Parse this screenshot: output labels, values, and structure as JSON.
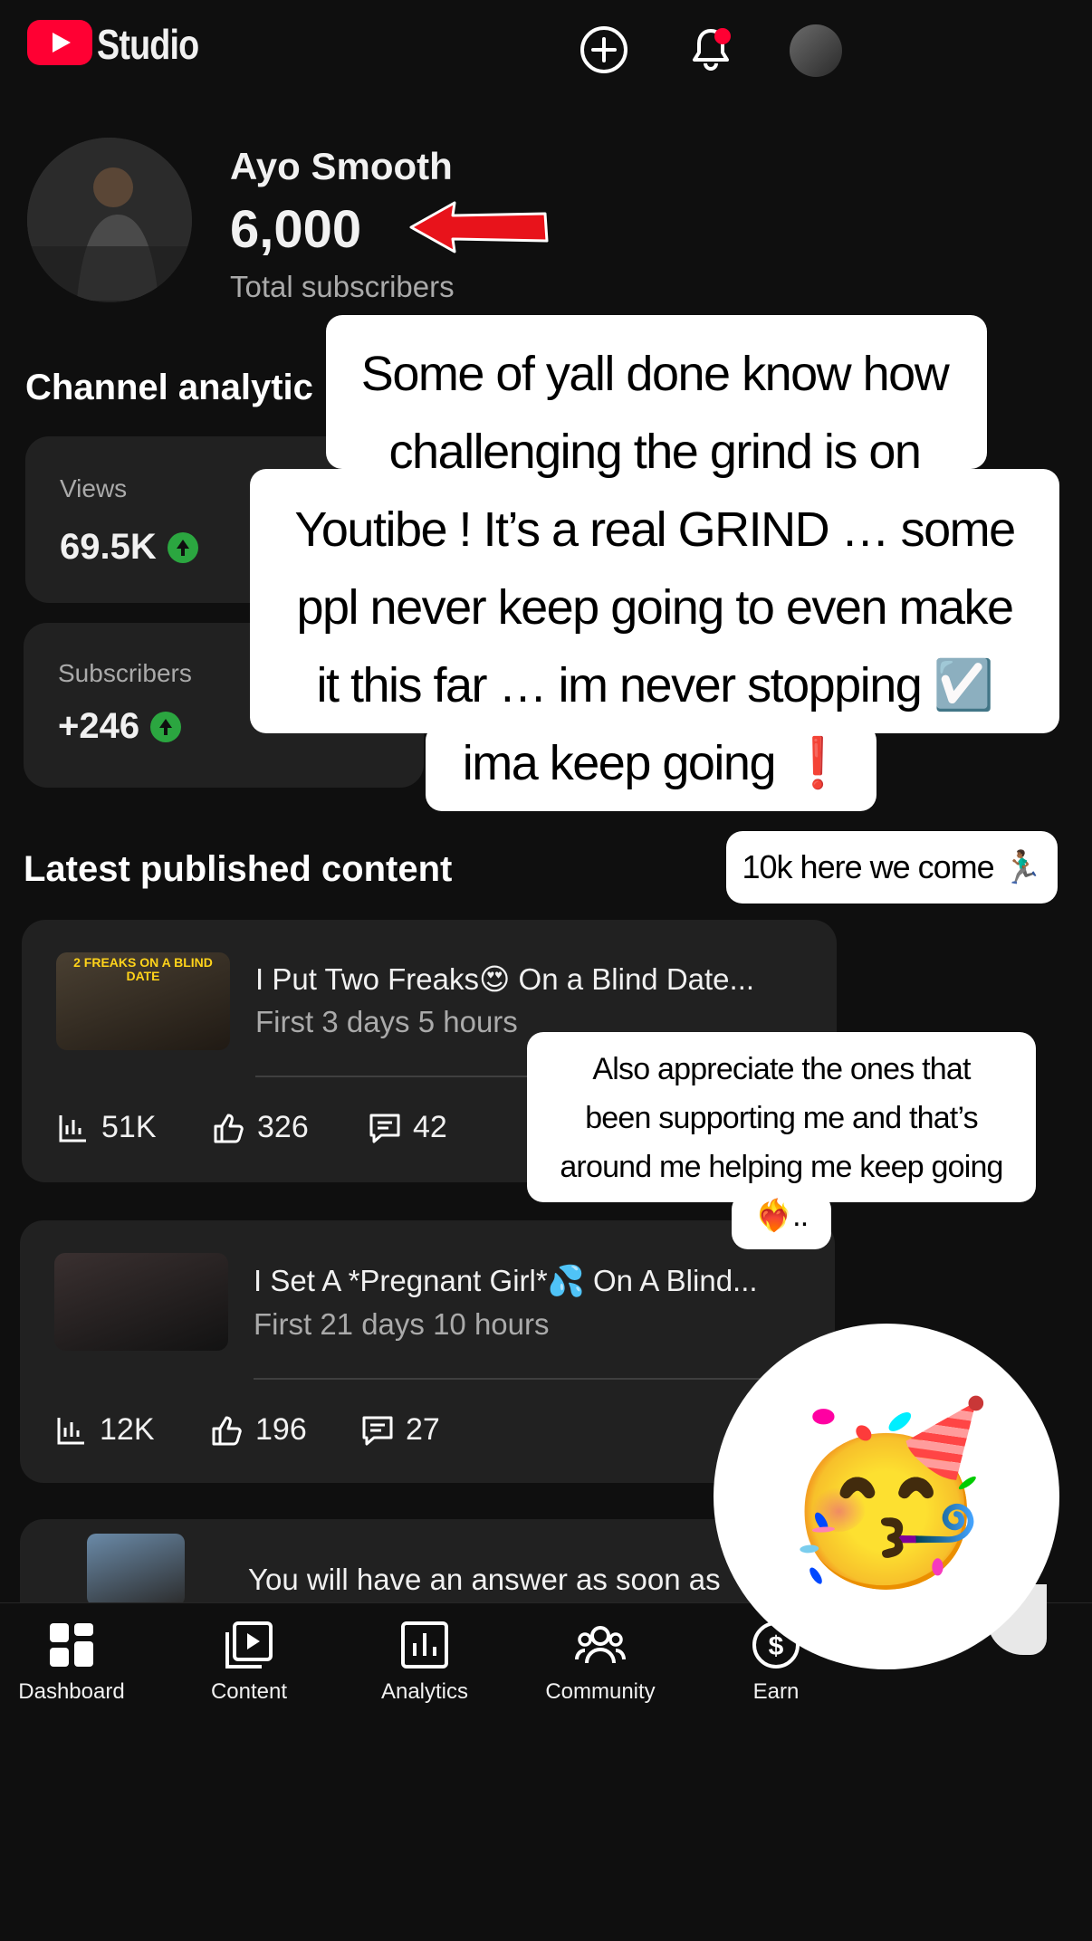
{
  "header": {
    "brand": "Studio",
    "create_icon": "add-circle-icon",
    "notification_icon": "bell-icon",
    "account_icon": "avatar"
  },
  "channel": {
    "name": "Ayo Smooth",
    "subscribers": "6,000",
    "subscribers_label": "Total subscribers"
  },
  "analytics": {
    "title": "Channel analytic",
    "views_label": "Views",
    "views_value": "69.5K",
    "subs_label": "Subscribers",
    "subs_value": "+246"
  },
  "story": {
    "main_lines": [
      "Some of yall done know how",
      "challenging the grind is on",
      "Youtibe ! It’s a real GRIND … some",
      "ppl never keep going to even make",
      "it this far … im never stopping ☑️",
      "ima keep going ❗"
    ],
    "tenk": "10k here we come 🏃🏾‍♂️",
    "appreciate_lines": [
      "Also appreciate the ones that",
      "been supporting me and that’s",
      "around me helping me keep going",
      "❤️‍🔥.."
    ],
    "party_emoji": "🥳"
  },
  "latest": {
    "title": "Latest published content",
    "videos": [
      {
        "thumb_text": "2 FREAKS ON A BLIND DATE",
        "title": "I Put Two Freaks😍 On a Blind Date...",
        "sub": "First 3 days 5 hours",
        "views": "51K",
        "likes": "326",
        "comments": "42"
      },
      {
        "title": "I Set A *Pregnant Girl*💦 On A Blind...",
        "sub": "First 21 days 10 hours",
        "views": "12K",
        "likes": "196",
        "comments": "27"
      },
      {
        "title": "You will have an answer as soon as"
      }
    ]
  },
  "nav": {
    "items": [
      {
        "label": "Dashboard",
        "icon": "dashboard-icon"
      },
      {
        "label": "Content",
        "icon": "content-icon"
      },
      {
        "label": "Analytics",
        "icon": "analytics-icon"
      },
      {
        "label": "Community",
        "icon": "community-icon"
      },
      {
        "label": "Earn",
        "icon": "earn-icon"
      }
    ]
  },
  "colors": {
    "background": "#0f0f0f",
    "card": "#212121",
    "brand_red": "#ff0033",
    "up_green": "#2ba640"
  }
}
